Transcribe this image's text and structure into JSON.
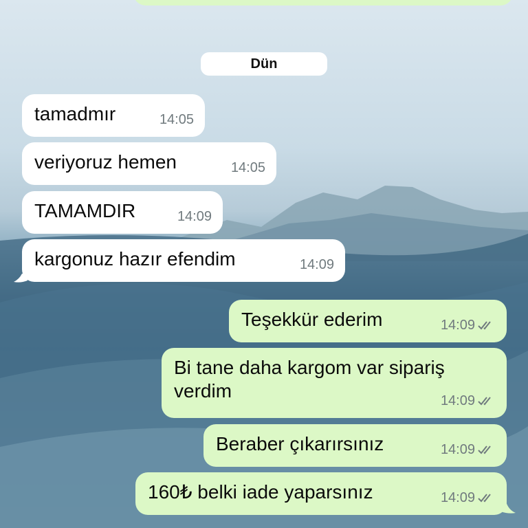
{
  "date_separator": "Dün",
  "messages": [
    {
      "text": "tamadmır",
      "time": "14:05"
    },
    {
      "text": "veriyoruz hemen",
      "time": "14:05"
    },
    {
      "text": "TAMAMDIR",
      "time": "14:09"
    },
    {
      "text": "kargonuz hazır efendim",
      "time": "14:09"
    },
    {
      "text": "Teşekkür ederim",
      "time": "14:09"
    },
    {
      "text": "Bi tane daha kargom var sipariş verdim",
      "time": "14:09"
    },
    {
      "text": "Beraber çıkarırsınız",
      "time": "14:09"
    },
    {
      "text": "160₺ belki iade yaparsınız",
      "time": "14:09"
    }
  ],
  "colors": {
    "incoming_bubble": "#ffffff",
    "outgoing_bubble": "#dcf8c6",
    "timestamp": "#707a7e",
    "read_ticks": "#707a7e"
  },
  "icons": [
    "double-check-icon"
  ]
}
